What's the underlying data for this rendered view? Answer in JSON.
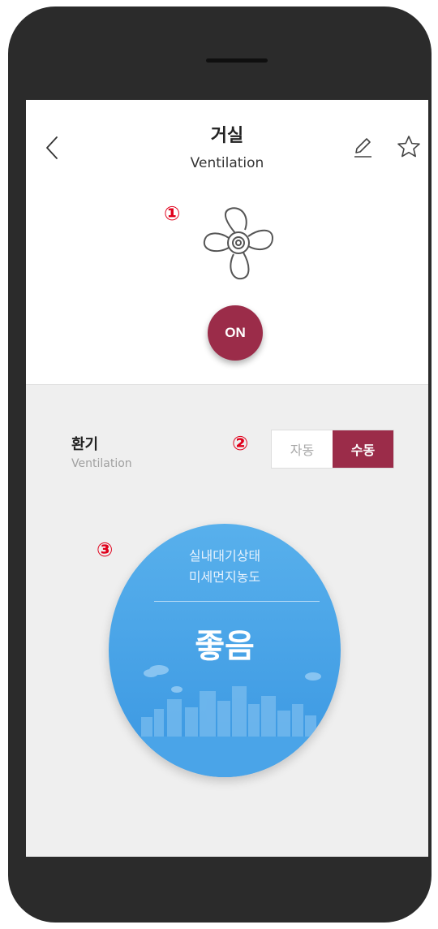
{
  "header": {
    "title": "거실",
    "subtitle": "Ventilation"
  },
  "annotations": {
    "marker1": "①",
    "marker2": "②",
    "marker3": "③"
  },
  "power": {
    "label": "ON",
    "color": "#9b2c49"
  },
  "ventilation": {
    "label": "환기",
    "sub_label": "Ventilation",
    "modes": [
      "자동",
      "수동"
    ],
    "selected_mode": "수동"
  },
  "air_quality": {
    "line1": "실내대기상태",
    "line2": "미세먼지농도",
    "status": "좋음",
    "color": "#3a97e2"
  },
  "icons": [
    "chevron-left-icon",
    "pencil-icon",
    "star-icon",
    "fan-icon"
  ]
}
